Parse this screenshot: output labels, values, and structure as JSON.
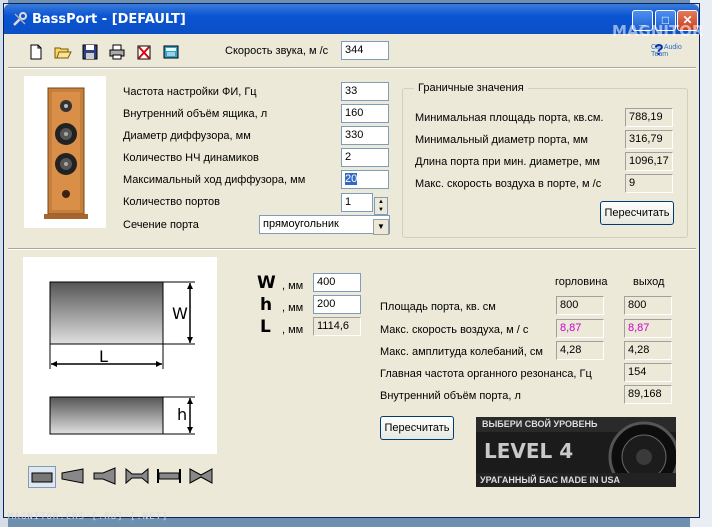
{
  "window": {
    "title": "BassPort - [DEFAULT]"
  },
  "watermark": {
    "text": "MAGNITOR",
    "sub": "Car Audio Team"
  },
  "toolbar": {
    "icons": [
      "new-file-icon",
      "open-folder-icon",
      "save-icon",
      "print-icon",
      "delete-icon",
      "calculator-icon"
    ],
    "sound_speed_label": "Скорость звука, м /с",
    "sound_speed_value": "344"
  },
  "params": {
    "rows": [
      {
        "label": "Частота настройки ФИ, Гц",
        "value": "33"
      },
      {
        "label": "Внутренний объём ящика, л",
        "value": "160"
      },
      {
        "label": "Диаметр диффузора, мм",
        "value": "330"
      },
      {
        "label": "Количество НЧ динамиков",
        "value": "2"
      },
      {
        "label": "Максимальный ход диффузора, мм",
        "value": "20"
      },
      {
        "label": "Количество портов",
        "value": "1"
      },
      {
        "label": "Сечение порта",
        "value": "прямоугольник"
      }
    ]
  },
  "limits": {
    "title": "Граничные значения",
    "rows": [
      {
        "label": "Минимальная площадь порта, кв.см.",
        "value": "788,19"
      },
      {
        "label": "Минимальный диаметр порта, мм",
        "value": "316,79"
      },
      {
        "label": "Длина порта при мин. диаметре, мм",
        "value": "1096,17"
      },
      {
        "label": "Макс. скорость воздуха в порте, м /с",
        "value": "9"
      }
    ],
    "recalc_label": "Пересчитать"
  },
  "dims": {
    "W": {
      "letter": "W",
      "unit": ", мм",
      "value": "400"
    },
    "h": {
      "letter": "h",
      "unit": ", мм",
      "value": "200"
    },
    "L": {
      "letter": "L",
      "unit": ", мм",
      "value": "1114,6"
    }
  },
  "diagram": {
    "w": "W",
    "l": "L",
    "h": "h"
  },
  "results": {
    "col_throat": "горловина",
    "col_exit": "выход",
    "rows": [
      {
        "label": "Площадь порта, кв. см",
        "throat": "800",
        "exit": "800"
      },
      {
        "label": "Макс. скорость воздуха, м / с",
        "throat": "8,87",
        "exit": "8,87"
      },
      {
        "label": "Макс. амплитуда колебаний, см",
        "throat": "4,28",
        "exit": "4,28"
      },
      {
        "label": "Главная частота органного резонанса, Гц",
        "value": "154"
      },
      {
        "label": "Внутренний объём порта, л",
        "value": "89,168"
      }
    ],
    "recalc_label": "Пересчитать"
  },
  "banner": {
    "top": "ВЫБЕРИ СВОЙ УРОВЕНЬ",
    "main": "LEVEL 4",
    "bottom": "УРАГАННЫЙ БАС MADE IN USA"
  },
  "footer": "MAGNITOR.CRS [.RU] [.NET]",
  "colors": {
    "highlight": "#cc00cc",
    "title_bar": "#0a54d3"
  }
}
